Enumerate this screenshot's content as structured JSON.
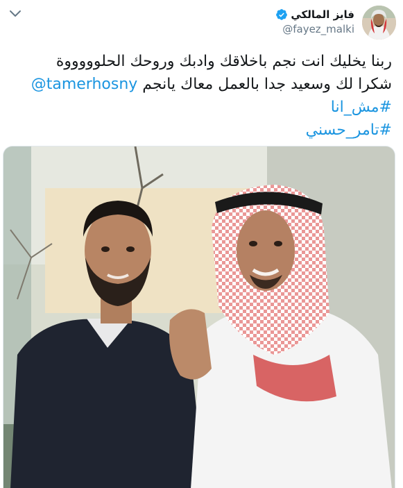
{
  "user": {
    "display_name": "فايز المالكي",
    "handle": "@fayez_malki",
    "verified": true
  },
  "tweet": {
    "line1": "ربنا يخليك انت نجم باخلاقك وادبك وروحك الحلوووووة",
    "line2_text": "شكرا لك وسعيد جدا بالعمل معاك يانجم",
    "mention": "@tamerhosny",
    "hashtag1": "#مش_انا",
    "hashtag2": "#تامر_حسني"
  },
  "media": {
    "type": "photo"
  },
  "colors": {
    "link": "#1b95e0",
    "verified": "#1da1f2",
    "secondary_text": "#657786"
  },
  "icons": {
    "verified": "verified-badge-icon",
    "more": "chevron-down-icon"
  }
}
